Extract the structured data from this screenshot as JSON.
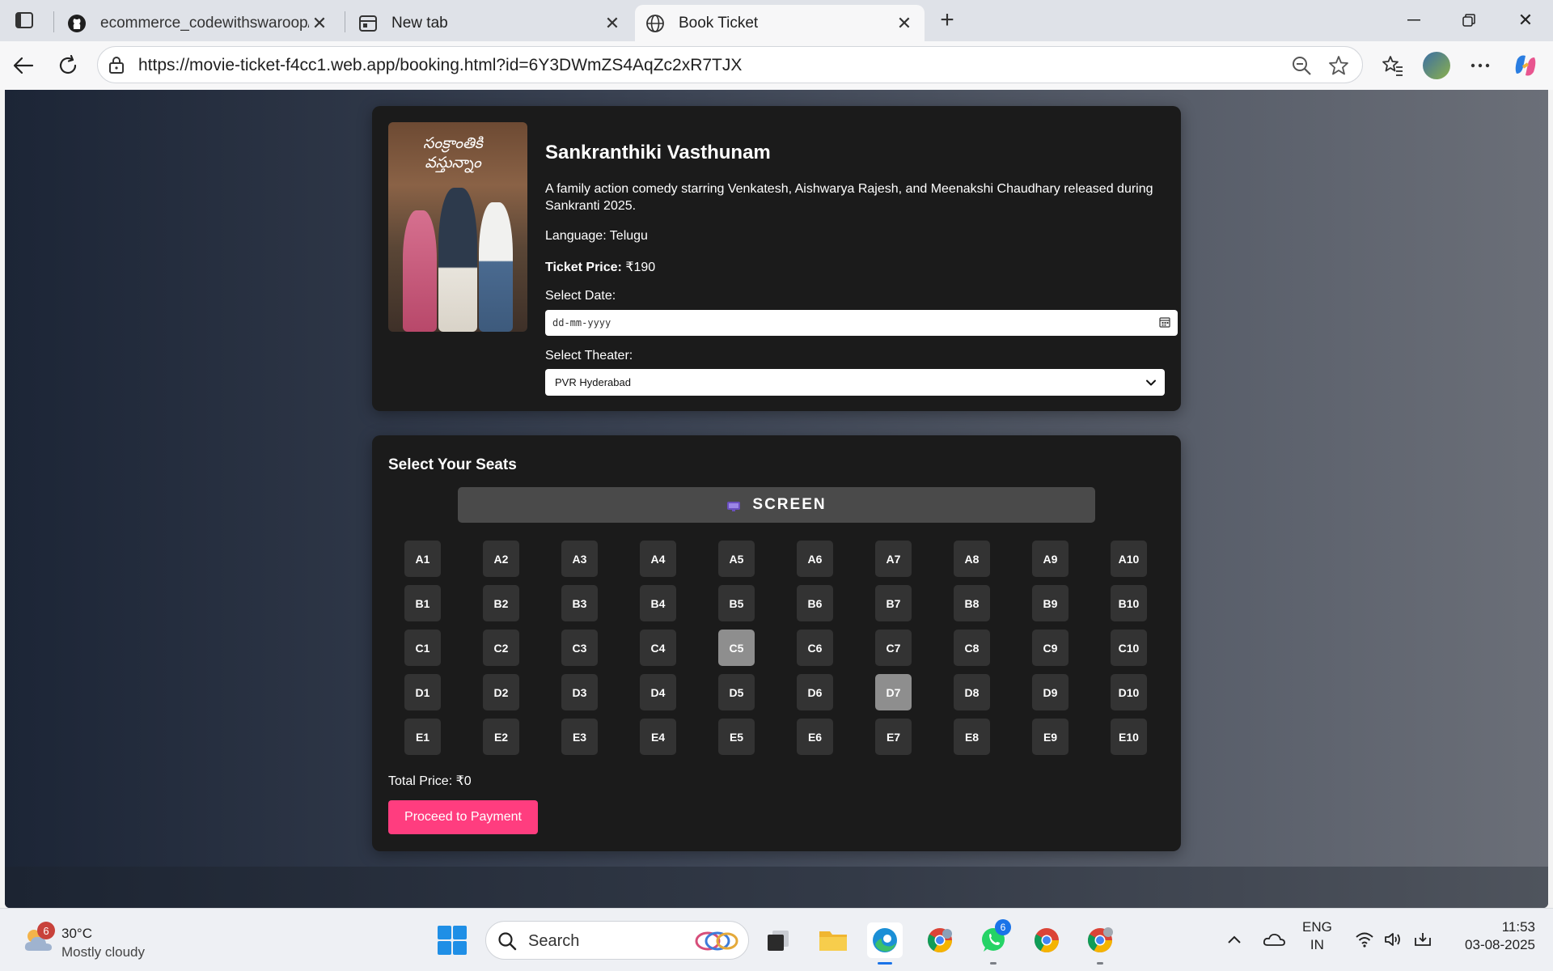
{
  "browser": {
    "tabs": [
      {
        "title": "ecommerce_codewithswaroop/03",
        "favicon": "github-icon",
        "active": false
      },
      {
        "title": "New tab",
        "favicon": "new-tab-icon",
        "active": false
      },
      {
        "title": "Book Ticket",
        "favicon": "globe-icon",
        "active": true
      }
    ],
    "url": "https://movie-ticket-f4cc1.web.app/booking.html?id=6Y3DWmZS4AqZc2xR7TJX"
  },
  "movie": {
    "poster_title": "సంక్రాంతికి వస్తున్నాం",
    "title": "Sankranthiki Vasthunam",
    "description": "A family action comedy starring Venkatesh, Aishwarya Rajesh, and Meenakshi Chaudhary released during Sankranti 2025.",
    "language": "Language: Telugu",
    "price_label": "Ticket Price:",
    "price_value": " ₹190",
    "date_label": "Select Date:",
    "date_placeholder": "dd-mm-yyyy",
    "theater_label": "Select Theater:",
    "theater_selected": "PVR Hyderabad"
  },
  "seating": {
    "heading": "Select Your Seats",
    "screen_label": "SCREEN",
    "rows": [
      "A",
      "B",
      "C",
      "D",
      "E"
    ],
    "columns": 10,
    "booked": [
      "C5",
      "D7"
    ],
    "seat_color": "#333333",
    "booked_color": "#8e8e8e",
    "total_price": "Total Price: ₹0",
    "pay_button": "Proceed to Payment",
    "accent": "#ff3d7f"
  },
  "taskbar": {
    "weather_badge": "6",
    "temperature": "30°C",
    "condition": "Mostly cloudy",
    "search_label": "Search",
    "whatsapp_badge": "6",
    "lang_top": "ENG",
    "lang_bottom": "IN",
    "time": "11:53",
    "date": "03-08-2025"
  }
}
